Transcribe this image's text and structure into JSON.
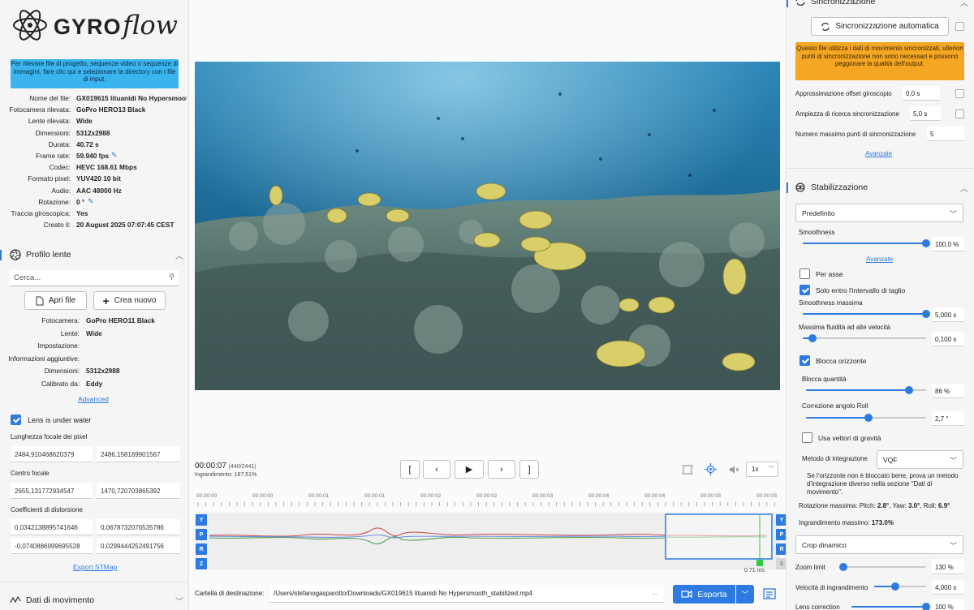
{
  "colors": {
    "accent": "#2d7be0",
    "info_banner": "#3ab4ef",
    "warning": "#f5a623",
    "roll_curve": "#d05050",
    "pitch_curve": "#50a050",
    "yaw_curve": "#7090e0",
    "marker": "#2ecc40"
  },
  "app": {
    "logo_text": "GYRO",
    "logo_script": "flow"
  },
  "left": {
    "info_banner": "Per rilevare file di progetto, sequenze video o sequenze di immagini, fare clic qui e selezionare la directory con i file di input.",
    "file_info": [
      {
        "k": "Nome del file:",
        "v": "GX019615 lituanidi No Hypersmoot"
      },
      {
        "k": "Fotocamera rilevata:",
        "v": "GoPro HERO13 Black"
      },
      {
        "k": "Lente rilevata:",
        "v": "Wide"
      },
      {
        "k": "Dimensioni:",
        "v": "5312x2988"
      },
      {
        "k": "Durata:",
        "v": "40.72 s"
      },
      {
        "k": "Frame rate:",
        "v": "59.940 fps"
      },
      {
        "k": "Codec:",
        "v": "HEVC 168.61 Mbps"
      },
      {
        "k": "Formato pixel:",
        "v": "YUV420 10 bit"
      },
      {
        "k": "Audio:",
        "v": "AAC 48000 Hz"
      },
      {
        "k": "Rotazione:",
        "v": "0 °"
      },
      {
        "k": "Traccia giroscopica:",
        "v": "Yes"
      },
      {
        "k": "Creato il:",
        "v": "20 August 2025 07:07:45 CEST"
      }
    ],
    "lens_profile": {
      "title": "Profilo lente",
      "search_placeholder": "Cerca...",
      "open_file": "Apri file",
      "create_new": "Crea nuovo",
      "info": [
        {
          "k": "Fotocamera:",
          "v": "GoPro HERO11 Black"
        },
        {
          "k": "Lente:",
          "v": "Wide"
        },
        {
          "k": "Impostazione:",
          "v": ""
        },
        {
          "k": "Informazioni aggiuntive:",
          "v": ""
        },
        {
          "k": "Dimensioni:",
          "v": "5312x2988"
        },
        {
          "k": "Calibrato da:",
          "v": "Eddy"
        }
      ],
      "advanced": "Advanced",
      "underwater_label": "Lens is under water",
      "underwater_checked": true,
      "focal_label": "Lunghezza focale dei pixel",
      "focal": [
        "2484,910468620379",
        "2486,158169901567"
      ],
      "center_label": "Centro focale",
      "center": [
        "2655,131772934547",
        "1470,720703865392"
      ],
      "dist_label": "Coefficienti di distorsione",
      "dist": [
        "0,0342138895741646",
        "0,0678732076535786",
        "-0,0740886999695528",
        "0,0299444252491756"
      ],
      "export_stmap": "Export STMap"
    },
    "motion_data_title": "Dati di movimento"
  },
  "center": {
    "time": "00:00:07",
    "frame_info": "(440/2441)",
    "zoom_text": "Ingrandimento: 167.51%",
    "playback_buttons": [
      "[",
      "‹",
      "▶",
      "›",
      "]"
    ],
    "speed": "1x",
    "timeline_labels": [
      "00:00:00",
      "00:00:00",
      "00:00:01",
      "00:00:01",
      "00:00:02",
      "00:00:02",
      "00:00:03",
      "00:00:04",
      "00:00:04",
      "00:00:05",
      "00:00:05"
    ],
    "axes_left": [
      "Y",
      "P",
      "R",
      "Z"
    ],
    "axes_right": [
      "Y",
      "P",
      "R",
      "S"
    ],
    "marker_label": "0.71 ms",
    "dest_label": "Cartella di destinazione:",
    "dest_path": "/Users/stefanogasparotto/Downloads/GX019615 lituanidi No Hypersmooth_stabilized.mp4",
    "dest_dots": "...",
    "export_label": "Esporta"
  },
  "right": {
    "sync": {
      "title": "Sincronizzazione",
      "auto_button": "Sincronizzazione automatica",
      "warning": "Questo file utilizza i dati di movimento sincronizzati, ulteriori punti di sincronizzazione non sono necessari e possono peggiorare la qualità dell'output.",
      "gyro_offset_label": "Approssimazione offset giroscopio",
      "gyro_offset": "0,0 s",
      "search_label": "Ampiezza di ricerca sincronizzazione",
      "search_value": "5,0 s",
      "max_points_label": "Numero massimo punti di sincronizzazione",
      "max_points": "5",
      "advanced": "Avanzate"
    },
    "stab": {
      "title": "Stabilizzazione",
      "preset": "Predefinito",
      "smoothness_label": "Smoothness",
      "smoothness": "100,0 %",
      "smoothness_frac": 1.0,
      "advanced": "Avanzate",
      "per_axis_label": "Per asse",
      "per_axis_checked": false,
      "trim_label": "Solo entro l'intervallo di taglio",
      "trim_checked": true,
      "max_smooth_label": "Smoothness massima",
      "max_smooth": "5,000 s",
      "max_smooth_frac": 1.0,
      "high_speed_label": "Massima fluidità ad alte velocità",
      "high_speed": "0,100 s",
      "high_speed_frac": 0.08,
      "horizon_label": "Blocca orizzonte",
      "horizon_checked": true,
      "lock_amount_label": "Blocca quantità",
      "lock_amount": "86 %",
      "lock_amount_frac": 0.86,
      "roll_label": "Correzione angolo Roll",
      "roll": "2,7 °",
      "roll_frac": 0.52,
      "gravity_label": "Usa vettori di gravità",
      "gravity_checked": false,
      "integration_label": "Metodo di integrazione",
      "integration": "VQF",
      "integration_note": "Se l'orizzonte non è bloccato bene, prova un metodo d'integrazione diverso nella sezione \"Dati di movimento\".",
      "max_rotation_prefix": "Rotazione massima: Pitch:",
      "max_pitch": "2.8°",
      "yaw_prefix": ", Yaw:",
      "max_yaw": "3.0°",
      "roll_prefix": ", Roll:",
      "max_roll": "6.9°",
      "max_zoom_prefix": "Ingrandimento massimo:",
      "max_zoom": "173.0%",
      "crop_mode": "Crop dinamico",
      "zoom_limit_label": "Zoom limit",
      "zoom_limit": "130 %",
      "zoom_limit_frac": 0.05,
      "zoom_speed_label": "Velocità di ingrandimento",
      "zoom_speed": "4,000 s",
      "zoom_speed_frac": 0.4,
      "lens_correction_label": "Lens correction",
      "lens_correction": "100 %",
      "lens_correction_frac": 1.0
    }
  }
}
